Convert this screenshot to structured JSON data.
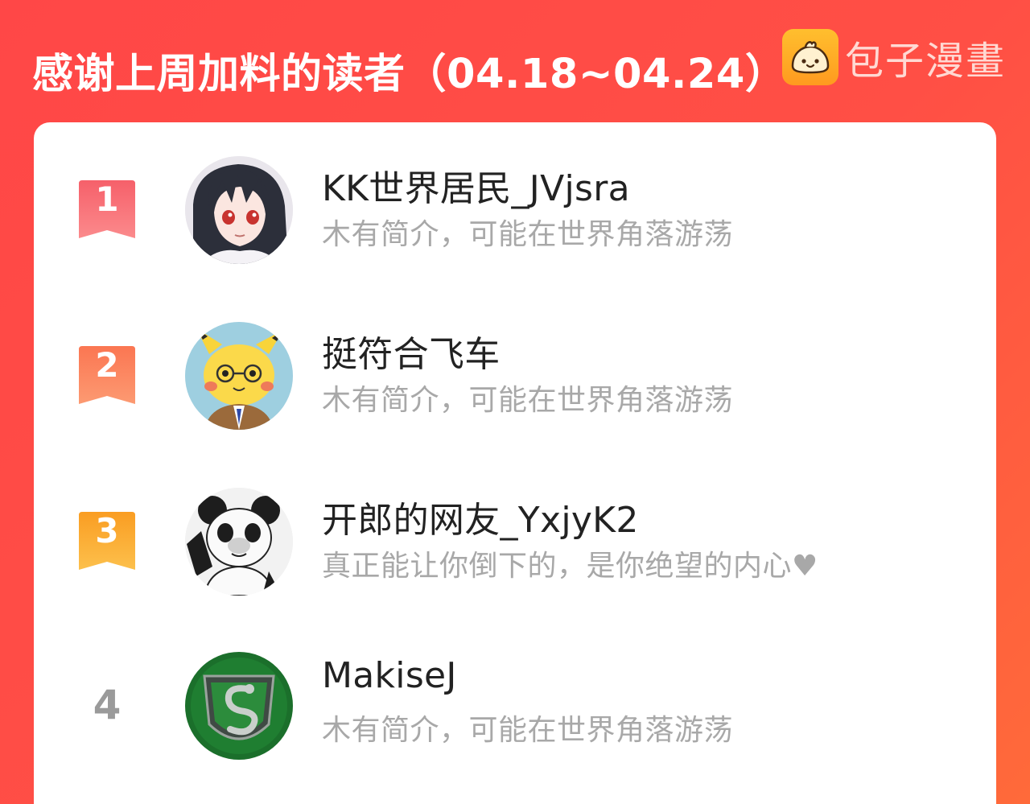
{
  "header": {
    "title": "感谢上周加料的读者（04.18~04.24）",
    "brand_name": "包子漫畫",
    "brand_icon": "bun-logo-icon"
  },
  "colors": {
    "background": "#ff4a46",
    "card": "#ffffff",
    "rank1": "#f8636a",
    "rank2": "#fb7e5e",
    "rank3": "#fbab2c",
    "rank_plain": "#9a9a9a",
    "name": "#222222",
    "bio": "#a8a8a8"
  },
  "readers": [
    {
      "rank": "1",
      "name": "KK世界居民_JVjsra",
      "bio": "木有简介，可能在世界角落游荡",
      "avatar_icon": "anime-girl-avatar"
    },
    {
      "rank": "2",
      "name": "挺符合飞车",
      "bio": "木有简介，可能在世界角落游荡",
      "avatar_icon": "pikachu-avatar"
    },
    {
      "rank": "3",
      "name": "开郎的网友_YxjyK2",
      "bio": "真正能让你倒下的，是你绝望的内心♥",
      "avatar_icon": "panda-meme-avatar"
    },
    {
      "rank": "4",
      "name": "MakiseJ",
      "bio": "木有简介，可能在世界角落游荡",
      "avatar_icon": "serpent-crest-avatar"
    }
  ]
}
